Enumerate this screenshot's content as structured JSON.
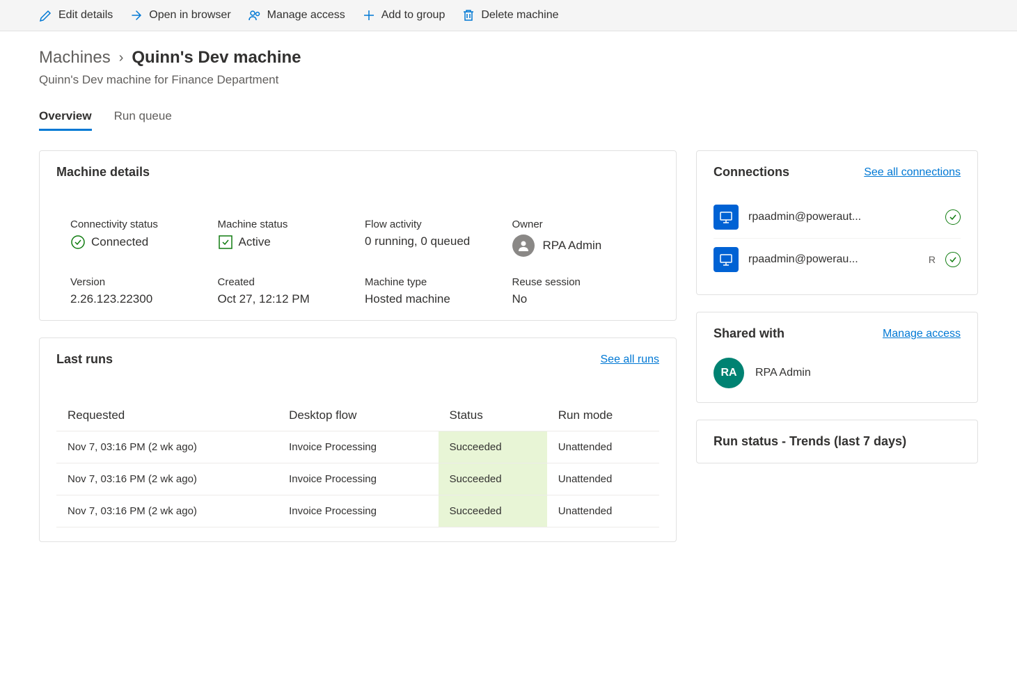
{
  "toolbar": {
    "edit": "Edit details",
    "open_browser": "Open in browser",
    "manage_access": "Manage access",
    "add_to_group": "Add to group",
    "delete_machine": "Delete machine"
  },
  "breadcrumb": {
    "parent": "Machines",
    "current": "Quinn's Dev machine"
  },
  "subtitle": "Quinn's Dev machine for Finance Department",
  "tabs": {
    "overview": "Overview",
    "run_queue": "Run queue"
  },
  "machine_details": {
    "title": "Machine details",
    "connectivity_label": "Connectivity status",
    "connectivity_value": "Connected",
    "machine_status_label": "Machine status",
    "machine_status_value": "Active",
    "flow_activity_label": "Flow activity",
    "flow_activity_value": "0 running, 0 queued",
    "owner_label": "Owner",
    "owner_value": "RPA Admin",
    "version_label": "Version",
    "version_value": "2.26.123.22300",
    "created_label": "Created",
    "created_value": "Oct 27, 12:12 PM",
    "machine_type_label": "Machine type",
    "machine_type_value": "Hosted machine",
    "reuse_label": "Reuse session",
    "reuse_value": "No"
  },
  "last_runs": {
    "title": "Last runs",
    "link": "See all runs",
    "col_requested": "Requested",
    "col_flow": "Desktop flow",
    "col_status": "Status",
    "col_mode": "Run mode",
    "rows": [
      {
        "requested": "Nov 7, 03:16 PM (2 wk ago)",
        "flow": "Invoice Processing",
        "status": "Succeeded",
        "mode": "Unattended"
      },
      {
        "requested": "Nov 7, 03:16 PM (2 wk ago)",
        "flow": "Invoice Processing",
        "status": "Succeeded",
        "mode": "Unattended"
      },
      {
        "requested": "Nov 7, 03:16 PM (2 wk ago)",
        "flow": "Invoice Processing",
        "status": "Succeeded",
        "mode": "Unattended"
      }
    ]
  },
  "connections": {
    "title": "Connections",
    "link": "See all connections",
    "items": [
      {
        "name": "rpaadmin@poweraut...",
        "extra": ""
      },
      {
        "name": "rpaadmin@powerau...",
        "extra": "R"
      }
    ]
  },
  "shared": {
    "title": "Shared with",
    "link": "Manage access",
    "initials": "RA",
    "name": "RPA Admin"
  },
  "run_status": {
    "title": "Run status - Trends (last 7 days)"
  }
}
